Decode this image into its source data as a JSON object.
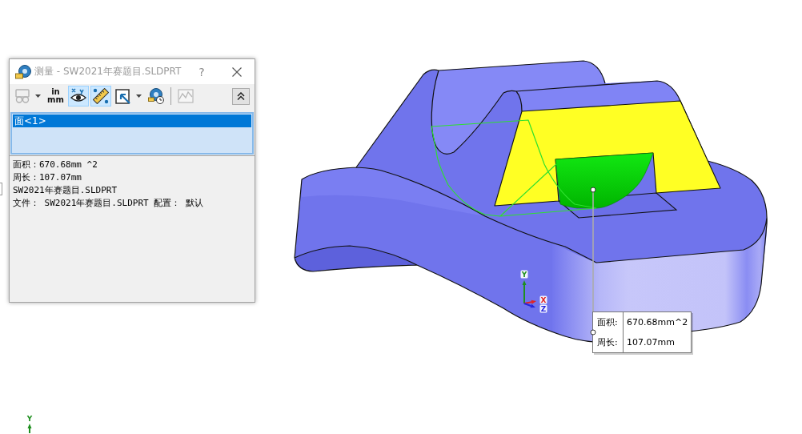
{
  "dialog": {
    "title": "测量 - SW2021年赛题目.SLDPRT",
    "help": "?"
  },
  "toolbar": {
    "groups": [
      [
        {
          "kind": "icon",
          "pressed": false,
          "disabled": true,
          "dropdown": true
        },
        {
          "kind": "text",
          "lines": [
            "in",
            "mm"
          ],
          "pressed": false,
          "disabled": false,
          "dropdown": false
        },
        {
          "kind": "icon",
          "pressed": true,
          "disabled": false,
          "dropdown": false
        },
        {
          "kind": "icon",
          "pressed": true,
          "disabled": false,
          "dropdown": false
        },
        {
          "kind": "icon",
          "pressed": false,
          "disabled": false,
          "dropdown": true
        },
        {
          "kind": "icon",
          "pressed": false,
          "disabled": false,
          "dropdown": false
        }
      ],
      [
        {
          "kind": "icon",
          "pressed": false,
          "disabled": true,
          "dropdown": false
        }
      ]
    ]
  },
  "selection_list": {
    "items": [
      {
        "label": "面<1>",
        "selected": true
      }
    ]
  },
  "results": {
    "lines": [
      "面积：670.68mm ^2",
      "周长：107.07mm",
      "SW2021年赛题目.SLDPRT",
      "文件： SW2021年赛题目.SLDPRT 配置： 默认"
    ]
  },
  "viewport": {
    "callout": {
      "rows": [
        {
          "label": "面积:",
          "value": "670.68mm^2"
        },
        {
          "label": "周长:",
          "value": "107.07mm"
        }
      ]
    },
    "triad": {
      "axes": [
        {
          "label": "Y",
          "color": "#1f8f1f"
        },
        {
          "label": "X",
          "color": "#e02424"
        },
        {
          "label": "Z",
          "color": "#2424e0"
        }
      ]
    },
    "mini_triad": {
      "axes": [
        {
          "label": "Y",
          "color": "#1f8f1f"
        }
      ]
    }
  }
}
